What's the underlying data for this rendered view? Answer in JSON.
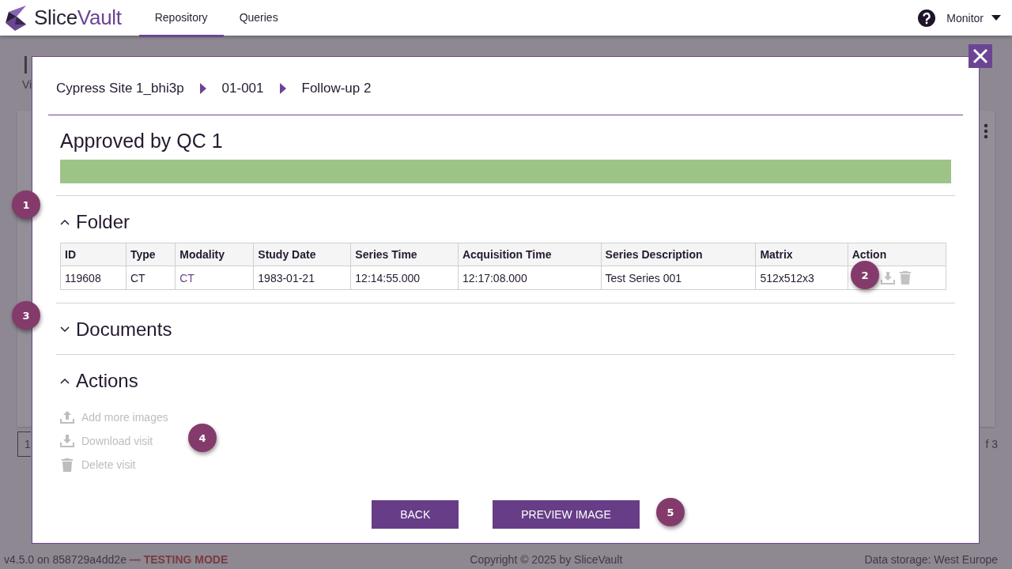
{
  "header": {
    "logo": {
      "part_1": "Slice",
      "part_2": "Vault"
    },
    "tabs": [
      {
        "label": "Repository",
        "selected": true
      },
      {
        "label": "Queries",
        "selected": false
      }
    ],
    "user": "Monitor"
  },
  "page": {
    "title": "I",
    "subtitle": "Vi",
    "pager": {
      "page": "1",
      "total": "f 3"
    }
  },
  "modal": {
    "breadcrumb": [
      "Cypress Site 1_bhi3p",
      "01-001",
      "Follow-up 2"
    ],
    "status": {
      "label": "Approved by QC 1",
      "color": "#9dc386",
      "level": 1
    },
    "sections": [
      {
        "kind": "table",
        "title": "Folder",
        "expanded": true,
        "table": {
          "columns": [
            "ID",
            "Type",
            "Modality",
            "Study Date",
            "Series Time",
            "Acquisition Time",
            "Series Description",
            "Matrix",
            "Action"
          ],
          "rows": [
            {
              "cells": [
                {
                  "text": "119608",
                  "kind": "text"
                },
                {
                  "text": "CT",
                  "kind": "text"
                },
                {
                  "text": "CT",
                  "kind": "link"
                },
                {
                  "text": "1983-01-21",
                  "kind": "text"
                },
                {
                  "text": "12:14:55.000",
                  "kind": "text"
                },
                {
                  "text": "12:17:08.000",
                  "kind": "text"
                },
                {
                  "text": "Test Series 001",
                  "kind": "text"
                },
                {
                  "text": "512x512x3",
                  "kind": "text"
                }
              ],
              "actions": [
                {
                  "kind": "download",
                  "disabled": true
                },
                {
                  "kind": "delete",
                  "disabled": true
                }
              ]
            }
          ]
        }
      },
      {
        "title": "Documents",
        "expanded": false
      },
      {
        "kind": "actions",
        "title": "Actions",
        "expanded": true,
        "items": [
          {
            "kind": "upload",
            "label": "Add more images",
            "disabled": true
          },
          {
            "kind": "download",
            "label": "Download visit",
            "disabled": true
          },
          {
            "kind": "delete",
            "label": "Delete visit",
            "disabled": true
          }
        ]
      }
    ],
    "buttons": [
      "BACK",
      "PREVIEW IMAGE"
    ]
  },
  "annotations": [
    "1",
    "2",
    "3",
    "4",
    "5"
  ],
  "footer": {
    "version": "v4.5.0 on 858729a4dd2e",
    "mode": "— TESTING MODE",
    "copyright": "Copyright © 2025 by SliceVault",
    "storage": "Data storage: West Europe"
  }
}
